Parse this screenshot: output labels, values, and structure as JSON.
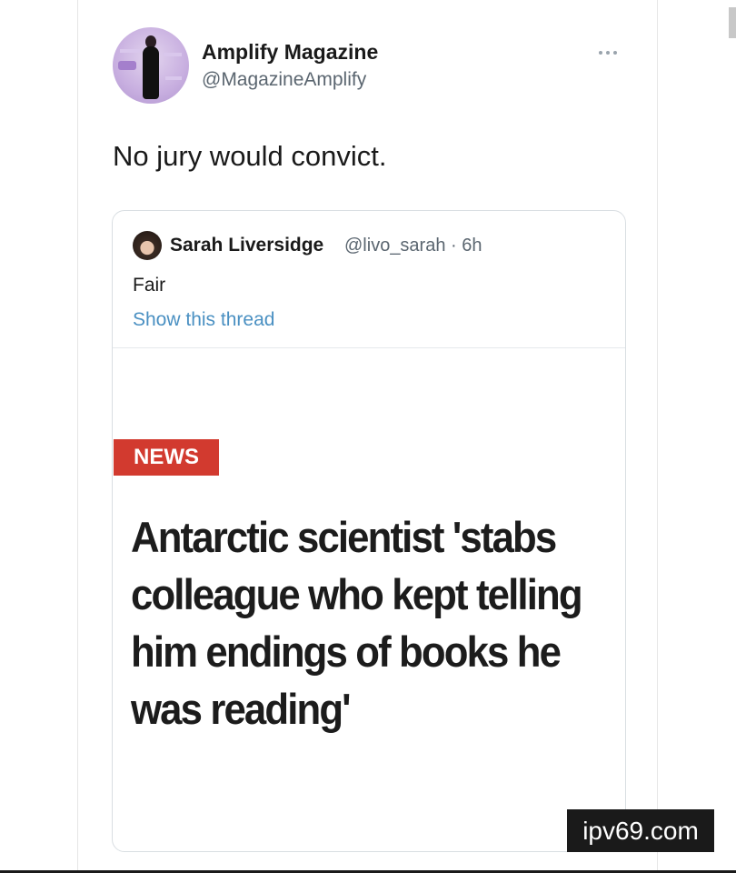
{
  "tweet": {
    "author_name": "Amplify Magazine",
    "author_handle": "@MagazineAmplify",
    "text": "No jury would convict.",
    "more_icon": "ellipsis-icon"
  },
  "quoted_tweet": {
    "author_name": "Sarah Liversidge",
    "meta": "@livo_sarah · 6h",
    "text": "Fair",
    "thread_link": "Show this thread",
    "badge": "NEWS",
    "headline_lines": [
      "Antarctic scientist 'stabs",
      "colleague who kept telling",
      "him endings of books he",
      "was reading'"
    ]
  },
  "watermark": "ipv69.com",
  "colors": {
    "badge": "#d23a2f",
    "link": "#4a90c2",
    "muted_text": "#5b6670"
  }
}
